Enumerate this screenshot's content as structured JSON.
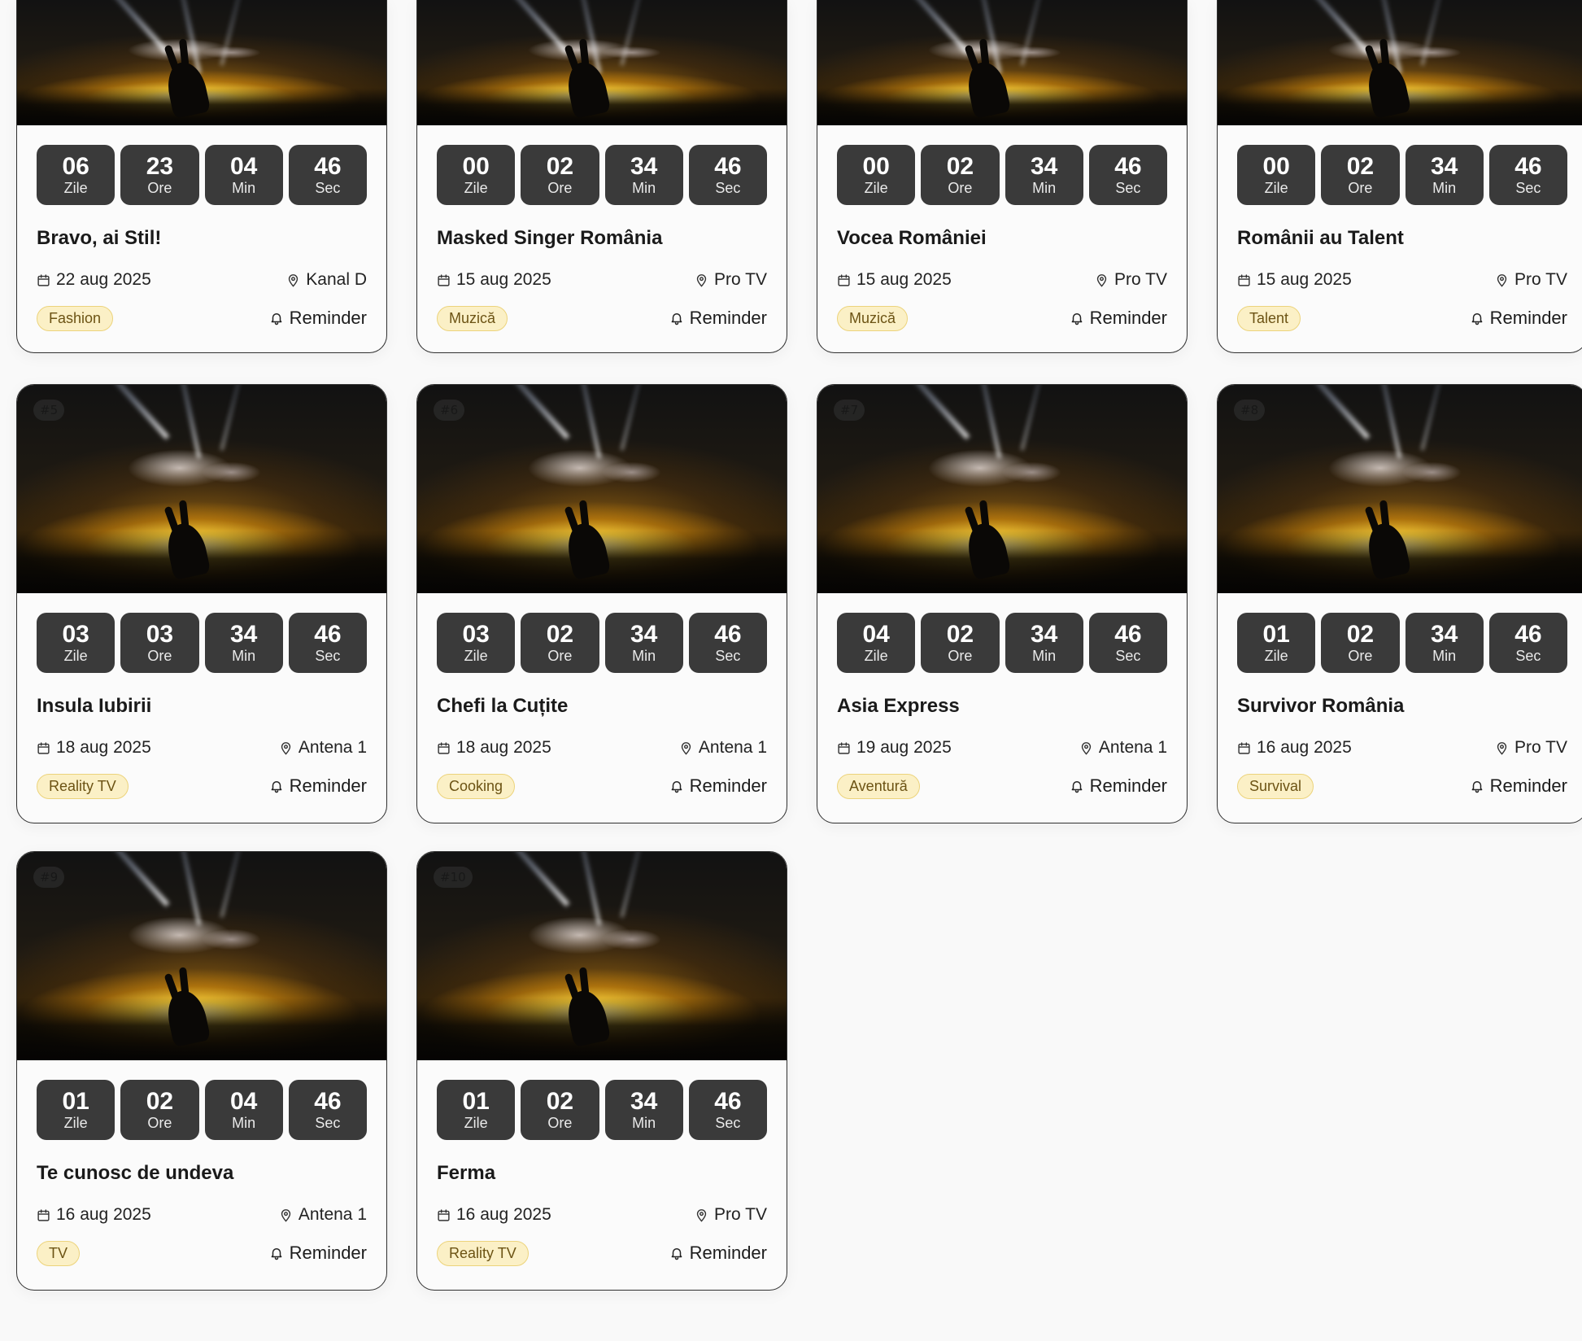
{
  "cards": [
    {
      "rank": "",
      "countdown": [
        {
          "num": "06",
          "unit": "Zile"
        },
        {
          "num": "23",
          "unit": "Ore"
        },
        {
          "num": "04",
          "unit": "Min"
        },
        {
          "num": "46",
          "unit": "Sec"
        }
      ],
      "title": "Bravo, ai Stil!",
      "date": "22 aug 2025",
      "channel": "Kanal D",
      "tag": "Fashion",
      "reminder": "Reminder"
    },
    {
      "rank": "",
      "countdown": [
        {
          "num": "00",
          "unit": "Zile"
        },
        {
          "num": "02",
          "unit": "Ore"
        },
        {
          "num": "34",
          "unit": "Min"
        },
        {
          "num": "46",
          "unit": "Sec"
        }
      ],
      "title": "Masked Singer România",
      "date": "15 aug 2025",
      "channel": "Pro TV",
      "tag": "Muzică",
      "reminder": "Reminder"
    },
    {
      "rank": "",
      "countdown": [
        {
          "num": "00",
          "unit": "Zile"
        },
        {
          "num": "02",
          "unit": "Ore"
        },
        {
          "num": "34",
          "unit": "Min"
        },
        {
          "num": "46",
          "unit": "Sec"
        }
      ],
      "title": "Vocea României",
      "date": "15 aug 2025",
      "channel": "Pro TV",
      "tag": "Muzică",
      "reminder": "Reminder"
    },
    {
      "rank": "",
      "countdown": [
        {
          "num": "00",
          "unit": "Zile"
        },
        {
          "num": "02",
          "unit": "Ore"
        },
        {
          "num": "34",
          "unit": "Min"
        },
        {
          "num": "46",
          "unit": "Sec"
        }
      ],
      "title": "Românii au Talent",
      "date": "15 aug 2025",
      "channel": "Pro TV",
      "tag": "Talent",
      "reminder": "Reminder"
    },
    {
      "rank": "#5",
      "countdown": [
        {
          "num": "03",
          "unit": "Zile"
        },
        {
          "num": "03",
          "unit": "Ore"
        },
        {
          "num": "34",
          "unit": "Min"
        },
        {
          "num": "46",
          "unit": "Sec"
        }
      ],
      "title": "Insula Iubirii",
      "date": "18 aug 2025",
      "channel": "Antena 1",
      "tag": "Reality TV",
      "reminder": "Reminder"
    },
    {
      "rank": "#6",
      "countdown": [
        {
          "num": "03",
          "unit": "Zile"
        },
        {
          "num": "02",
          "unit": "Ore"
        },
        {
          "num": "34",
          "unit": "Min"
        },
        {
          "num": "46",
          "unit": "Sec"
        }
      ],
      "title": "Chefi la Cuțite",
      "date": "18 aug 2025",
      "channel": "Antena 1",
      "tag": "Cooking",
      "reminder": "Reminder"
    },
    {
      "rank": "#7",
      "countdown": [
        {
          "num": "04",
          "unit": "Zile"
        },
        {
          "num": "02",
          "unit": "Ore"
        },
        {
          "num": "34",
          "unit": "Min"
        },
        {
          "num": "46",
          "unit": "Sec"
        }
      ],
      "title": "Asia Express",
      "date": "19 aug 2025",
      "channel": "Antena 1",
      "tag": "Aventură",
      "reminder": "Reminder"
    },
    {
      "rank": "#8",
      "countdown": [
        {
          "num": "01",
          "unit": "Zile"
        },
        {
          "num": "02",
          "unit": "Ore"
        },
        {
          "num": "34",
          "unit": "Min"
        },
        {
          "num": "46",
          "unit": "Sec"
        }
      ],
      "title": "Survivor România",
      "date": "16 aug 2025",
      "channel": "Pro TV",
      "tag": "Survival",
      "reminder": "Reminder"
    },
    {
      "rank": "#9",
      "countdown": [
        {
          "num": "01",
          "unit": "Zile"
        },
        {
          "num": "02",
          "unit": "Ore"
        },
        {
          "num": "04",
          "unit": "Min"
        },
        {
          "num": "46",
          "unit": "Sec"
        }
      ],
      "title": "Te cunosc de undeva",
      "date": "16 aug 2025",
      "channel": "Antena 1",
      "tag": "TV",
      "reminder": "Reminder"
    },
    {
      "rank": "#10",
      "countdown": [
        {
          "num": "01",
          "unit": "Zile"
        },
        {
          "num": "02",
          "unit": "Ore"
        },
        {
          "num": "34",
          "unit": "Min"
        },
        {
          "num": "46",
          "unit": "Sec"
        }
      ],
      "title": "Ferma",
      "date": "16 aug 2025",
      "channel": "Pro TV",
      "tag": "Reality TV",
      "reminder": "Reminder"
    }
  ],
  "icons": {
    "date": "calendar-icon",
    "channel": "map-pin-icon",
    "reminder": "bell-icon"
  },
  "colors": {
    "countdown_bg": "#3a3a3a",
    "tag_bg": "#fbf0c6",
    "tag_border": "#ecd37b",
    "tag_text": "#6c5314",
    "card_border": "#303030"
  }
}
